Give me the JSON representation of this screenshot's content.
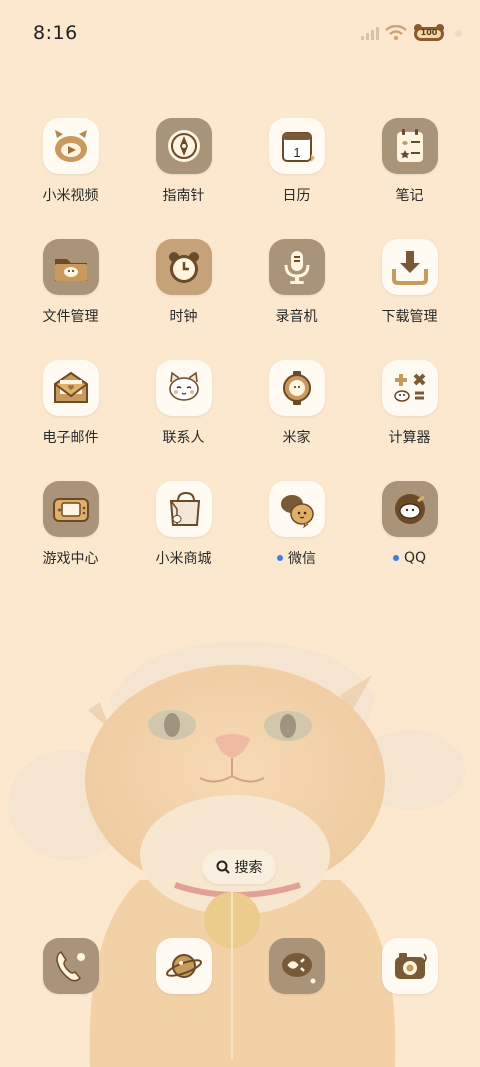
{
  "status_bar": {
    "time": "8:16",
    "battery": "100"
  },
  "apps": [
    [
      {
        "label": "小米视频",
        "icon": "video-icon",
        "style": "light",
        "dot": false
      },
      {
        "label": "指南针",
        "icon": "compass-icon",
        "style": "dark",
        "dot": false
      },
      {
        "label": "日历",
        "icon": "calendar-icon",
        "style": "light",
        "dot": false,
        "day": "1"
      },
      {
        "label": "笔记",
        "icon": "notes-icon",
        "style": "dark",
        "dot": false
      }
    ],
    [
      {
        "label": "文件管理",
        "icon": "folder-icon",
        "style": "dark",
        "dot": false
      },
      {
        "label": "时钟",
        "icon": "clock-icon",
        "style": "dark",
        "dot": false
      },
      {
        "label": "录音机",
        "icon": "recorder-icon",
        "style": "dark",
        "dot": false
      },
      {
        "label": "下载管理",
        "icon": "download-icon",
        "style": "light",
        "dot": false
      }
    ],
    [
      {
        "label": "电子邮件",
        "icon": "mail-icon",
        "style": "light",
        "dot": false
      },
      {
        "label": "联系人",
        "icon": "contacts-cat-icon",
        "style": "light",
        "dot": false
      },
      {
        "label": "米家",
        "icon": "mijia-icon",
        "style": "light",
        "dot": false
      },
      {
        "label": "计算器",
        "icon": "calculator-icon",
        "style": "light",
        "dot": false
      }
    ],
    [
      {
        "label": "游戏中心",
        "icon": "gamepad-icon",
        "style": "dark",
        "dot": false
      },
      {
        "label": "小米商城",
        "icon": "shopping-bag-icon",
        "style": "light",
        "dot": false
      },
      {
        "label": "微信",
        "icon": "wechat-icon",
        "style": "light",
        "dot": true
      },
      {
        "label": "QQ",
        "icon": "qq-icon",
        "style": "dark",
        "dot": true
      }
    ]
  ],
  "search": {
    "label": "搜索"
  },
  "dock": [
    {
      "icon": "phone-icon",
      "style": "dark"
    },
    {
      "icon": "browser-planet-icon",
      "style": "light"
    },
    {
      "icon": "messages-icon",
      "style": "dark"
    },
    {
      "icon": "camera-icon",
      "style": "light"
    }
  ],
  "colors": {
    "background": "#fbe8cf",
    "icon_dark": "#a99479",
    "icon_light": "#fffaf2",
    "accent_brown": "#8a6a43",
    "notification_dot": "#3b7de9"
  }
}
